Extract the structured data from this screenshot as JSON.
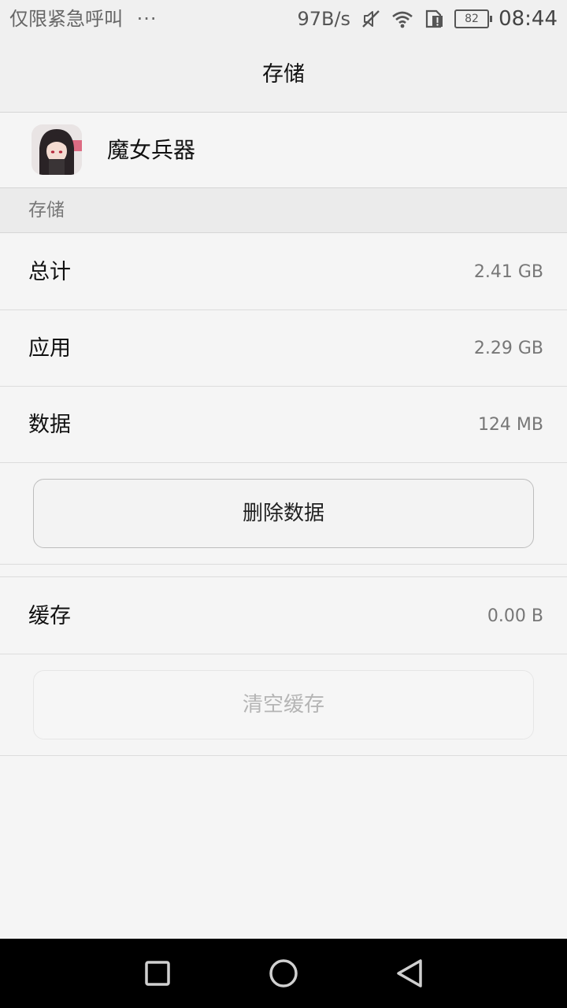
{
  "status_bar": {
    "carrier_text": "仅限紧急呼叫",
    "more": "···",
    "net_speed": "97B/s",
    "battery_level": "82",
    "time": "08:44",
    "icons": [
      "mute-icon",
      "wifi-icon",
      "sim-alert-icon",
      "battery-icon"
    ]
  },
  "title": "存储",
  "app": {
    "name": "魔女兵器",
    "icon": "app-icon"
  },
  "section_header": "存储",
  "storage_rows": [
    {
      "label": "总计",
      "value": "2.41 GB"
    },
    {
      "label": "应用",
      "value": "2.29 GB"
    },
    {
      "label": "数据",
      "value": "124 MB"
    }
  ],
  "delete_button": "删除数据",
  "cache_row": {
    "label": "缓存",
    "value": "0.00 B"
  },
  "clear_cache_button": "清空缓存",
  "nav_bar": {
    "icons": [
      "recents-icon",
      "home-icon",
      "back-icon"
    ]
  },
  "colors": {
    "background": "#f5f5f5",
    "header_background": "#f0f0f0",
    "section_background": "#ebebeb",
    "primary_text": "#111111",
    "secondary_text": "#777777",
    "disabled_text": "#b5b5b5",
    "nav_background": "#000000"
  }
}
